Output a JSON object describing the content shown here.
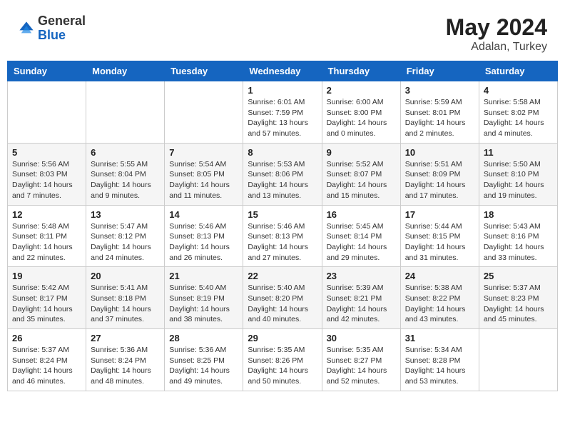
{
  "header": {
    "logo_general": "General",
    "logo_blue": "Blue",
    "month_year": "May 2024",
    "location": "Adalan, Turkey"
  },
  "weekdays": [
    "Sunday",
    "Monday",
    "Tuesday",
    "Wednesday",
    "Thursday",
    "Friday",
    "Saturday"
  ],
  "weeks": [
    [
      {
        "day": "",
        "info": ""
      },
      {
        "day": "",
        "info": ""
      },
      {
        "day": "",
        "info": ""
      },
      {
        "day": "1",
        "info": "Sunrise: 6:01 AM\nSunset: 7:59 PM\nDaylight: 13 hours\nand 57 minutes."
      },
      {
        "day": "2",
        "info": "Sunrise: 6:00 AM\nSunset: 8:00 PM\nDaylight: 14 hours\nand 0 minutes."
      },
      {
        "day": "3",
        "info": "Sunrise: 5:59 AM\nSunset: 8:01 PM\nDaylight: 14 hours\nand 2 minutes."
      },
      {
        "day": "4",
        "info": "Sunrise: 5:58 AM\nSunset: 8:02 PM\nDaylight: 14 hours\nand 4 minutes."
      }
    ],
    [
      {
        "day": "5",
        "info": "Sunrise: 5:56 AM\nSunset: 8:03 PM\nDaylight: 14 hours\nand 7 minutes."
      },
      {
        "day": "6",
        "info": "Sunrise: 5:55 AM\nSunset: 8:04 PM\nDaylight: 14 hours\nand 9 minutes."
      },
      {
        "day": "7",
        "info": "Sunrise: 5:54 AM\nSunset: 8:05 PM\nDaylight: 14 hours\nand 11 minutes."
      },
      {
        "day": "8",
        "info": "Sunrise: 5:53 AM\nSunset: 8:06 PM\nDaylight: 14 hours\nand 13 minutes."
      },
      {
        "day": "9",
        "info": "Sunrise: 5:52 AM\nSunset: 8:07 PM\nDaylight: 14 hours\nand 15 minutes."
      },
      {
        "day": "10",
        "info": "Sunrise: 5:51 AM\nSunset: 8:09 PM\nDaylight: 14 hours\nand 17 minutes."
      },
      {
        "day": "11",
        "info": "Sunrise: 5:50 AM\nSunset: 8:10 PM\nDaylight: 14 hours\nand 19 minutes."
      }
    ],
    [
      {
        "day": "12",
        "info": "Sunrise: 5:48 AM\nSunset: 8:11 PM\nDaylight: 14 hours\nand 22 minutes."
      },
      {
        "day": "13",
        "info": "Sunrise: 5:47 AM\nSunset: 8:12 PM\nDaylight: 14 hours\nand 24 minutes."
      },
      {
        "day": "14",
        "info": "Sunrise: 5:46 AM\nSunset: 8:13 PM\nDaylight: 14 hours\nand 26 minutes."
      },
      {
        "day": "15",
        "info": "Sunrise: 5:46 AM\nSunset: 8:13 PM\nDaylight: 14 hours\nand 27 minutes."
      },
      {
        "day": "16",
        "info": "Sunrise: 5:45 AM\nSunset: 8:14 PM\nDaylight: 14 hours\nand 29 minutes."
      },
      {
        "day": "17",
        "info": "Sunrise: 5:44 AM\nSunset: 8:15 PM\nDaylight: 14 hours\nand 31 minutes."
      },
      {
        "day": "18",
        "info": "Sunrise: 5:43 AM\nSunset: 8:16 PM\nDaylight: 14 hours\nand 33 minutes."
      }
    ],
    [
      {
        "day": "19",
        "info": "Sunrise: 5:42 AM\nSunset: 8:17 PM\nDaylight: 14 hours\nand 35 minutes."
      },
      {
        "day": "20",
        "info": "Sunrise: 5:41 AM\nSunset: 8:18 PM\nDaylight: 14 hours\nand 37 minutes."
      },
      {
        "day": "21",
        "info": "Sunrise: 5:40 AM\nSunset: 8:19 PM\nDaylight: 14 hours\nand 38 minutes."
      },
      {
        "day": "22",
        "info": "Sunrise: 5:40 AM\nSunset: 8:20 PM\nDaylight: 14 hours\nand 40 minutes."
      },
      {
        "day": "23",
        "info": "Sunrise: 5:39 AM\nSunset: 8:21 PM\nDaylight: 14 hours\nand 42 minutes."
      },
      {
        "day": "24",
        "info": "Sunrise: 5:38 AM\nSunset: 8:22 PM\nDaylight: 14 hours\nand 43 minutes."
      },
      {
        "day": "25",
        "info": "Sunrise: 5:37 AM\nSunset: 8:23 PM\nDaylight: 14 hours\nand 45 minutes."
      }
    ],
    [
      {
        "day": "26",
        "info": "Sunrise: 5:37 AM\nSunset: 8:24 PM\nDaylight: 14 hours\nand 46 minutes."
      },
      {
        "day": "27",
        "info": "Sunrise: 5:36 AM\nSunset: 8:24 PM\nDaylight: 14 hours\nand 48 minutes."
      },
      {
        "day": "28",
        "info": "Sunrise: 5:36 AM\nSunset: 8:25 PM\nDaylight: 14 hours\nand 49 minutes."
      },
      {
        "day": "29",
        "info": "Sunrise: 5:35 AM\nSunset: 8:26 PM\nDaylight: 14 hours\nand 50 minutes."
      },
      {
        "day": "30",
        "info": "Sunrise: 5:35 AM\nSunset: 8:27 PM\nDaylight: 14 hours\nand 52 minutes."
      },
      {
        "day": "31",
        "info": "Sunrise: 5:34 AM\nSunset: 8:28 PM\nDaylight: 14 hours\nand 53 minutes."
      },
      {
        "day": "",
        "info": ""
      }
    ]
  ]
}
